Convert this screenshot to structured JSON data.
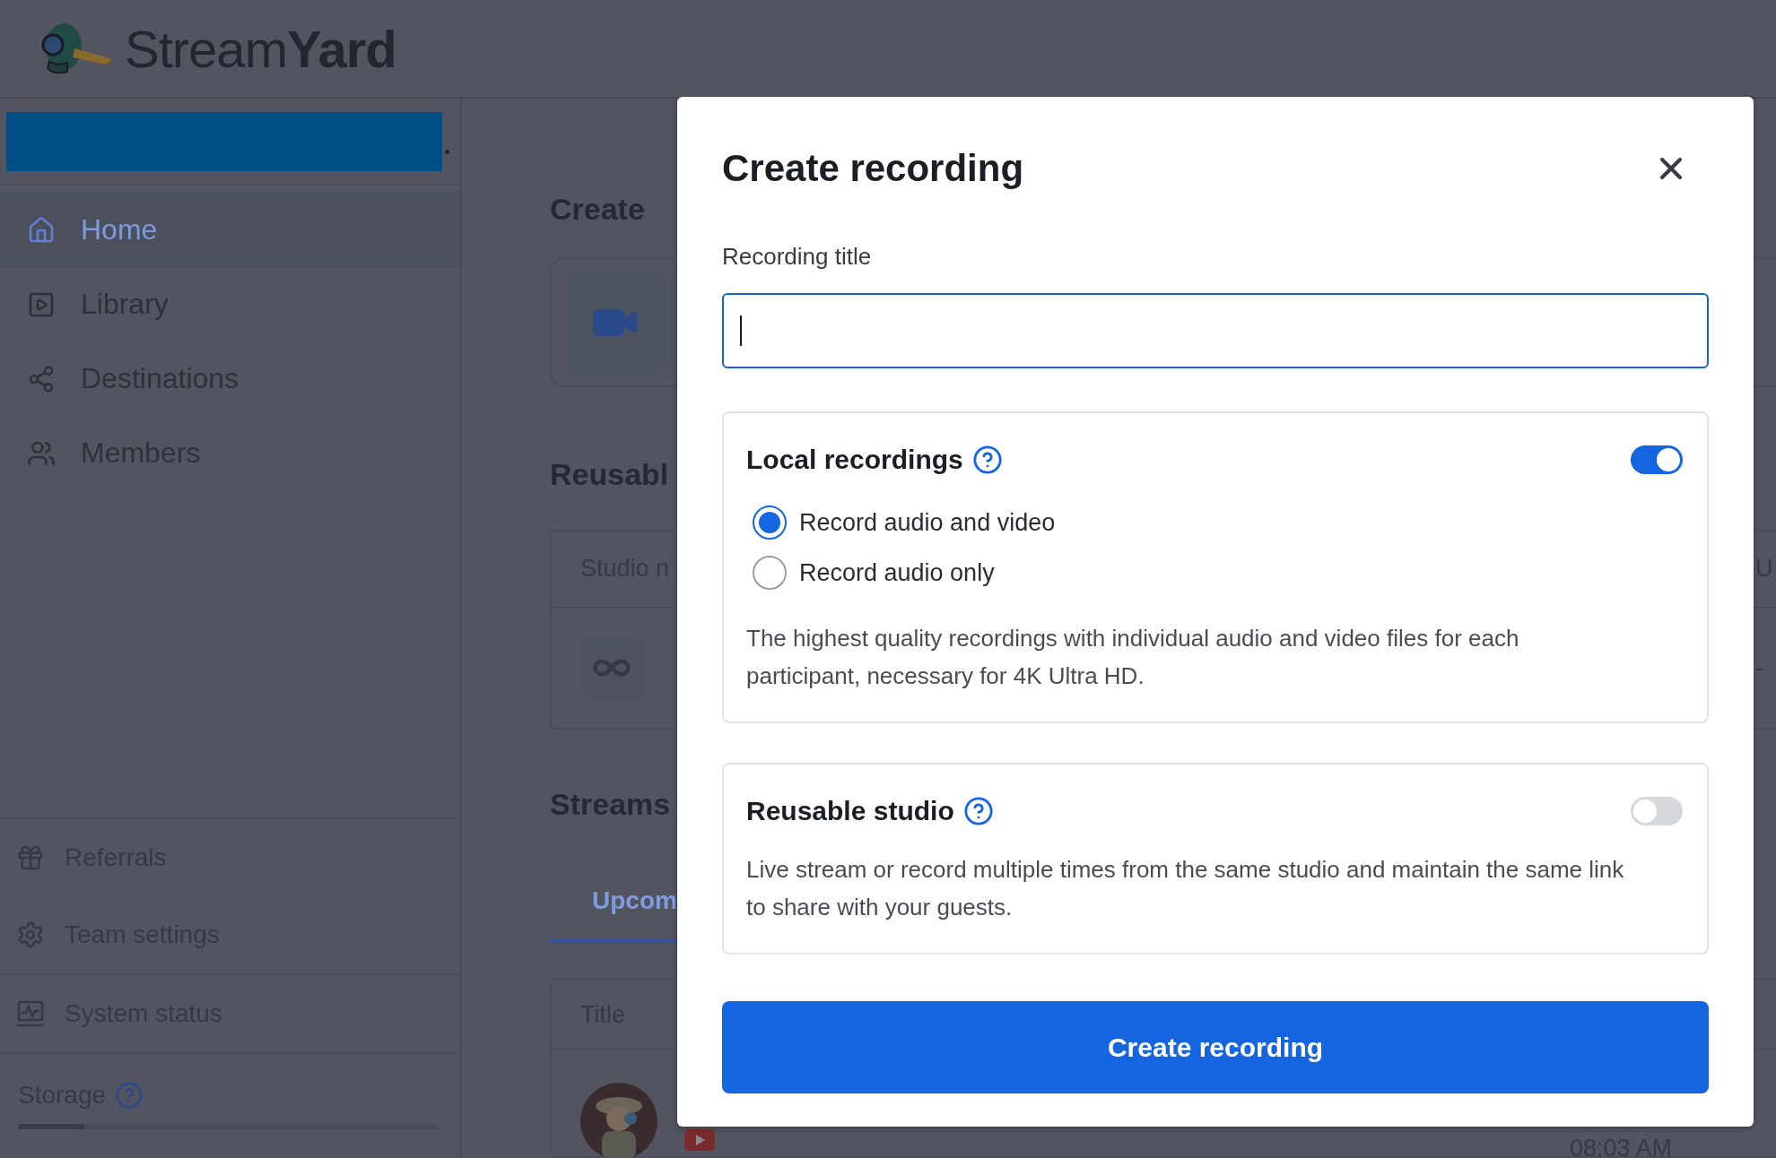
{
  "header": {
    "logo": "Stream**Yard**"
  },
  "sidebar": {
    "nav": [
      {
        "label": "Home",
        "selected": true
      },
      {
        "label": "Library",
        "selected": false
      },
      {
        "label": "Destinations",
        "selected": false
      },
      {
        "label": "Members",
        "selected": false
      }
    ],
    "footer_items": [
      "Referrals",
      "Team settings",
      "System status"
    ],
    "storage": {
      "label": "Storage",
      "level": 0.16
    }
  },
  "main": {
    "create": {
      "heading": "Create"
    },
    "reusable": {
      "heading": "Reusabl",
      "columns": [
        "Studio n",
        "U"
      ],
      "rows": [
        [
          "",
          "-"
        ]
      ]
    },
    "streams": {
      "heading": "Streams",
      "tabs": [
        {
          "label": "Upcom",
          "selected": true
        }
      ],
      "columns": [
        "Title"
      ],
      "rows": [
        {
          "time": "08:03 AM"
        }
      ]
    }
  },
  "modal": {
    "title": "Create recording",
    "field": {
      "label": "Recording title",
      "focused": true
    },
    "sections": [
      {
        "title": "Local recordings",
        "on": true,
        "options": [
          {
            "label": "Record audio and video",
            "selected": true
          },
          {
            "label": "Record audio only",
            "selected": false
          }
        ],
        "description": "The highest quality recordings with individual audio and video files for each participant, necessary for 4K Ultra HD."
      },
      {
        "title": "Reusable studio",
        "on": false,
        "description": "Live stream or record multiple times from the same studio and maintain the same link to share with your guests."
      }
    ],
    "submit": "Create recording"
  }
}
